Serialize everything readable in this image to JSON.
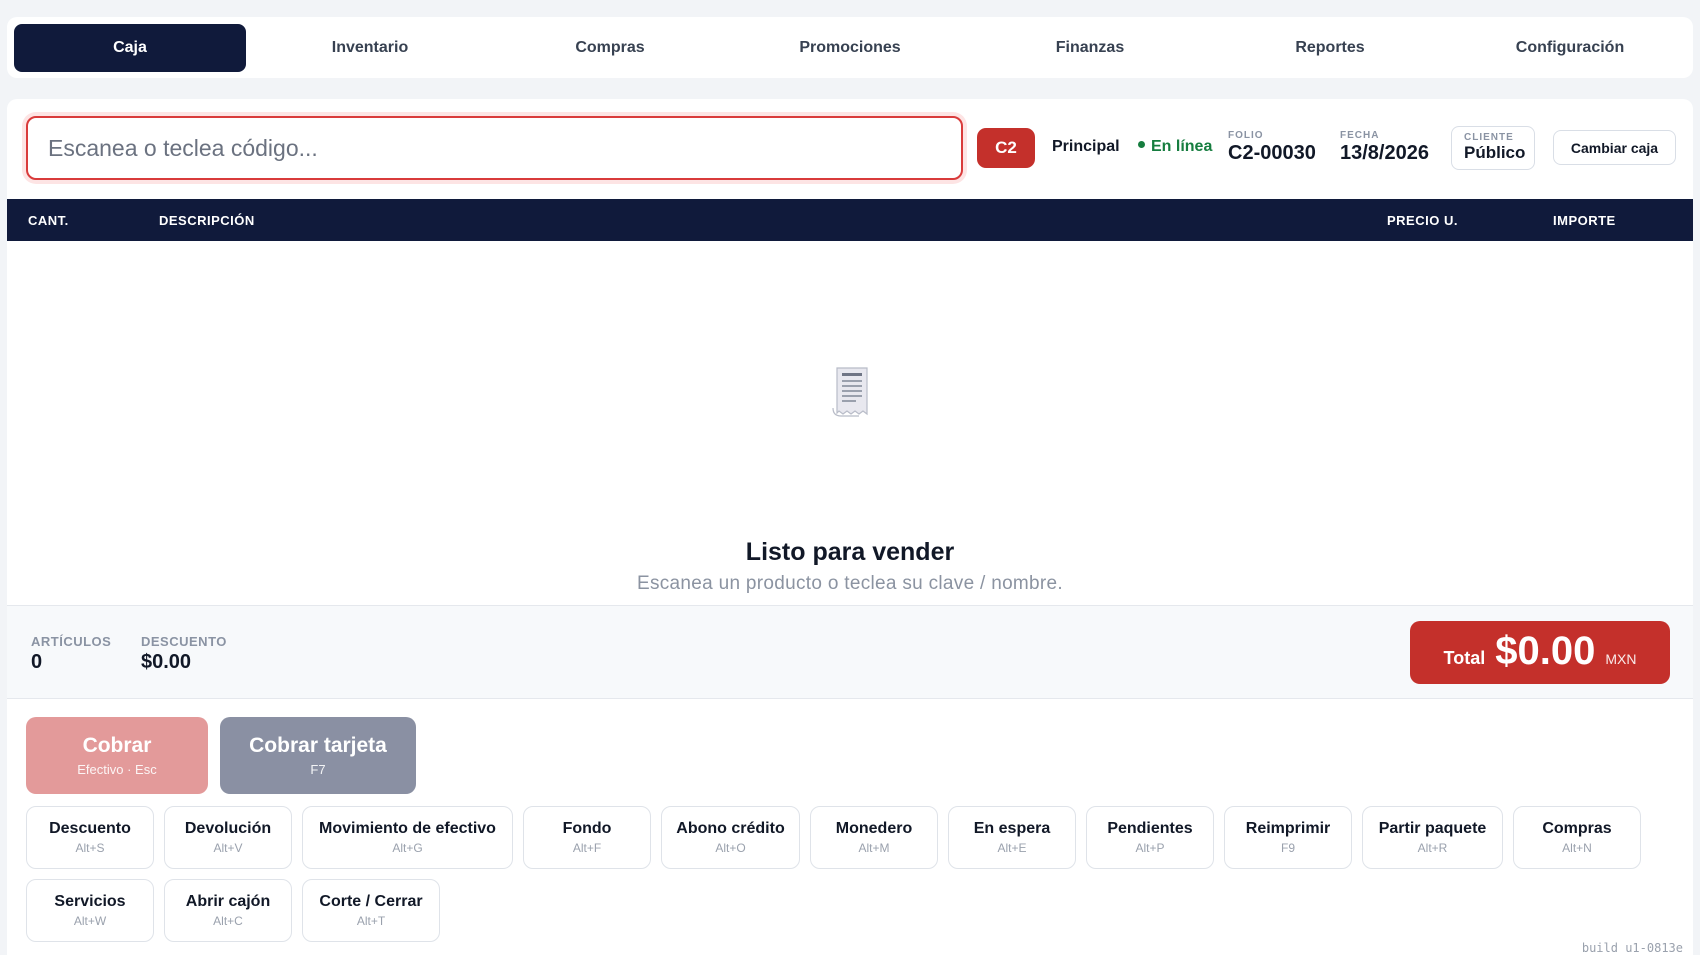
{
  "nav": {
    "tabs": [
      "Caja",
      "Inventario",
      "Compras",
      "Promociones",
      "Finanzas",
      "Reportes",
      "Configuración"
    ],
    "active": "Caja"
  },
  "topbar": {
    "scan_placeholder": "Escanea o teclea código...",
    "caja_badge": "C2",
    "sucursal": "Principal",
    "status": "En línea",
    "folio_label": "FOLIO",
    "folio_value": "C2-00030",
    "fecha_label": "FECHA",
    "fecha_value": "13/8/2026",
    "cliente_label": "CLIENTE",
    "cliente_value": "Público",
    "cambiar_caja": "Cambiar caja"
  },
  "table": {
    "headers": {
      "cant": "CANT.",
      "descripcion": "DESCRIPCIÓN",
      "precio": "PRECIO U.",
      "importe": "IMPORTE"
    }
  },
  "empty_state": {
    "icon": "receipt-icon",
    "title": "Listo para vender",
    "subtitle": "Escanea un producto o teclea su clave / nombre."
  },
  "summary": {
    "articulos_label": "ARTÍCULOS",
    "articulos_value": "0",
    "descuento_label": "DESCUENTO",
    "descuento_value": "$0.00",
    "total_label": "Total",
    "total_value": "$0.00",
    "currency": "MXN"
  },
  "pay": {
    "cash_label": "Cobrar",
    "cash_sub": "Efectivo · Esc",
    "card_label": "Cobrar tarjeta",
    "card_sub": "F7"
  },
  "actions": [
    {
      "label": "Descuento",
      "key": "Alt+S"
    },
    {
      "label": "Devolución",
      "key": "Alt+V"
    },
    {
      "label": "Movimiento de efectivo",
      "key": "Alt+G"
    },
    {
      "label": "Fondo",
      "key": "Alt+F"
    },
    {
      "label": "Abono crédito",
      "key": "Alt+O"
    },
    {
      "label": "Monedero",
      "key": "Alt+M"
    },
    {
      "label": "En espera",
      "key": "Alt+E"
    },
    {
      "label": "Pendientes",
      "key": "Alt+P"
    },
    {
      "label": "Reimprimir",
      "key": "F9"
    },
    {
      "label": "Partir paquete",
      "key": "Alt+R"
    },
    {
      "label": "Compras",
      "key": "Alt+N"
    },
    {
      "label": "Servicios",
      "key": "Alt+W"
    },
    {
      "label": "Abrir cajón",
      "key": "Alt+C"
    },
    {
      "label": "Corte / Cerrar",
      "key": "Alt+T"
    }
  ],
  "build": "build u1-0813e",
  "colors": {
    "navy": "#101a3b",
    "accent_red": "#c4302b",
    "online_green": "#167d3f"
  }
}
